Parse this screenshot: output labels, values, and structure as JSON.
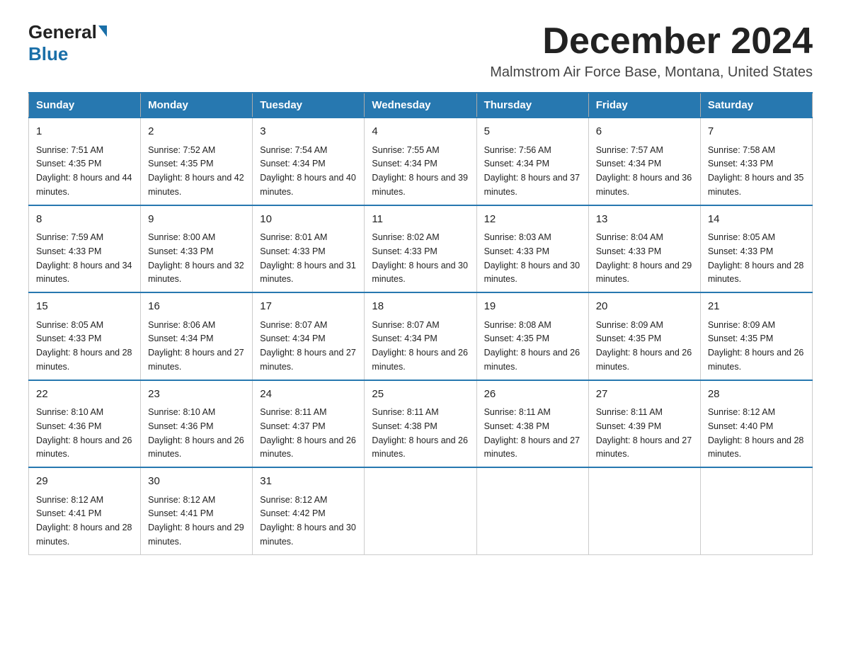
{
  "header": {
    "logo_general": "General",
    "logo_blue": "Blue",
    "month_title": "December 2024",
    "subtitle": "Malmstrom Air Force Base, Montana, United States"
  },
  "weekdays": [
    "Sunday",
    "Monday",
    "Tuesday",
    "Wednesday",
    "Thursday",
    "Friday",
    "Saturday"
  ],
  "weeks": [
    [
      {
        "day": "1",
        "sunrise": "7:51 AM",
        "sunset": "4:35 PM",
        "daylight": "8 hours and 44 minutes."
      },
      {
        "day": "2",
        "sunrise": "7:52 AM",
        "sunset": "4:35 PM",
        "daylight": "8 hours and 42 minutes."
      },
      {
        "day": "3",
        "sunrise": "7:54 AM",
        "sunset": "4:34 PM",
        "daylight": "8 hours and 40 minutes."
      },
      {
        "day": "4",
        "sunrise": "7:55 AM",
        "sunset": "4:34 PM",
        "daylight": "8 hours and 39 minutes."
      },
      {
        "day": "5",
        "sunrise": "7:56 AM",
        "sunset": "4:34 PM",
        "daylight": "8 hours and 37 minutes."
      },
      {
        "day": "6",
        "sunrise": "7:57 AM",
        "sunset": "4:34 PM",
        "daylight": "8 hours and 36 minutes."
      },
      {
        "day": "7",
        "sunrise": "7:58 AM",
        "sunset": "4:33 PM",
        "daylight": "8 hours and 35 minutes."
      }
    ],
    [
      {
        "day": "8",
        "sunrise": "7:59 AM",
        "sunset": "4:33 PM",
        "daylight": "8 hours and 34 minutes."
      },
      {
        "day": "9",
        "sunrise": "8:00 AM",
        "sunset": "4:33 PM",
        "daylight": "8 hours and 32 minutes."
      },
      {
        "day": "10",
        "sunrise": "8:01 AM",
        "sunset": "4:33 PM",
        "daylight": "8 hours and 31 minutes."
      },
      {
        "day": "11",
        "sunrise": "8:02 AM",
        "sunset": "4:33 PM",
        "daylight": "8 hours and 30 minutes."
      },
      {
        "day": "12",
        "sunrise": "8:03 AM",
        "sunset": "4:33 PM",
        "daylight": "8 hours and 30 minutes."
      },
      {
        "day": "13",
        "sunrise": "8:04 AM",
        "sunset": "4:33 PM",
        "daylight": "8 hours and 29 minutes."
      },
      {
        "day": "14",
        "sunrise": "8:05 AM",
        "sunset": "4:33 PM",
        "daylight": "8 hours and 28 minutes."
      }
    ],
    [
      {
        "day": "15",
        "sunrise": "8:05 AM",
        "sunset": "4:33 PM",
        "daylight": "8 hours and 28 minutes."
      },
      {
        "day": "16",
        "sunrise": "8:06 AM",
        "sunset": "4:34 PM",
        "daylight": "8 hours and 27 minutes."
      },
      {
        "day": "17",
        "sunrise": "8:07 AM",
        "sunset": "4:34 PM",
        "daylight": "8 hours and 27 minutes."
      },
      {
        "day": "18",
        "sunrise": "8:07 AM",
        "sunset": "4:34 PM",
        "daylight": "8 hours and 26 minutes."
      },
      {
        "day": "19",
        "sunrise": "8:08 AM",
        "sunset": "4:35 PM",
        "daylight": "8 hours and 26 minutes."
      },
      {
        "day": "20",
        "sunrise": "8:09 AM",
        "sunset": "4:35 PM",
        "daylight": "8 hours and 26 minutes."
      },
      {
        "day": "21",
        "sunrise": "8:09 AM",
        "sunset": "4:35 PM",
        "daylight": "8 hours and 26 minutes."
      }
    ],
    [
      {
        "day": "22",
        "sunrise": "8:10 AM",
        "sunset": "4:36 PM",
        "daylight": "8 hours and 26 minutes."
      },
      {
        "day": "23",
        "sunrise": "8:10 AM",
        "sunset": "4:36 PM",
        "daylight": "8 hours and 26 minutes."
      },
      {
        "day": "24",
        "sunrise": "8:11 AM",
        "sunset": "4:37 PM",
        "daylight": "8 hours and 26 minutes."
      },
      {
        "day": "25",
        "sunrise": "8:11 AM",
        "sunset": "4:38 PM",
        "daylight": "8 hours and 26 minutes."
      },
      {
        "day": "26",
        "sunrise": "8:11 AM",
        "sunset": "4:38 PM",
        "daylight": "8 hours and 27 minutes."
      },
      {
        "day": "27",
        "sunrise": "8:11 AM",
        "sunset": "4:39 PM",
        "daylight": "8 hours and 27 minutes."
      },
      {
        "day": "28",
        "sunrise": "8:12 AM",
        "sunset": "4:40 PM",
        "daylight": "8 hours and 28 minutes."
      }
    ],
    [
      {
        "day": "29",
        "sunrise": "8:12 AM",
        "sunset": "4:41 PM",
        "daylight": "8 hours and 28 minutes."
      },
      {
        "day": "30",
        "sunrise": "8:12 AM",
        "sunset": "4:41 PM",
        "daylight": "8 hours and 29 minutes."
      },
      {
        "day": "31",
        "sunrise": "8:12 AM",
        "sunset": "4:42 PM",
        "daylight": "8 hours and 30 minutes."
      },
      null,
      null,
      null,
      null
    ]
  ],
  "labels": {
    "sunrise": "Sunrise:",
    "sunset": "Sunset:",
    "daylight": "Daylight:"
  },
  "colors": {
    "header_bg": "#2778b0",
    "border_blue": "#2778b0",
    "logo_blue": "#1a6fa8"
  }
}
